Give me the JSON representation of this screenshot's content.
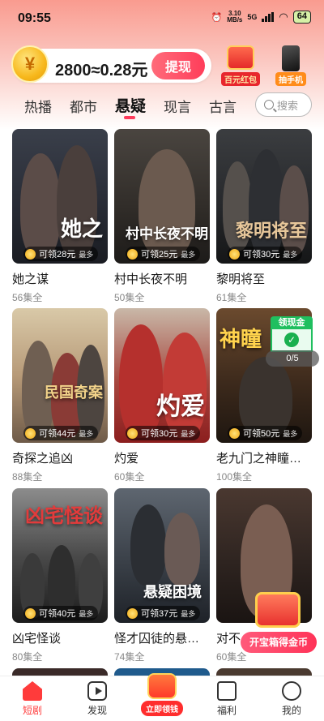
{
  "status_bar": {
    "time": "09:55",
    "net_speed": "3.10",
    "net_unit": "MB/s",
    "network": "5G",
    "battery": "64"
  },
  "reward": {
    "coin_symbol": "¥",
    "amount": "2800≈0.28元",
    "withdraw_label": "提现"
  },
  "promos": [
    {
      "label": "百元红包",
      "icon": "red-envelope-icon"
    },
    {
      "label": "抽手机",
      "icon": "phone-icon"
    }
  ],
  "tabs": [
    {
      "label": "热播",
      "active": false
    },
    {
      "label": "都市",
      "active": false
    },
    {
      "label": "悬疑",
      "active": true
    },
    {
      "label": "现言",
      "active": false
    },
    {
      "label": "古言",
      "active": false
    }
  ],
  "search": {
    "placeholder": "搜索"
  },
  "dramas": [
    {
      "title": "她之谋",
      "episodes": "56集全",
      "reward": "可领28元",
      "tag": "最多",
      "art_title": "她之"
    },
    {
      "title": "村中长夜不明",
      "episodes": "50集全",
      "reward": "可领25元",
      "tag": "最多",
      "art_title": "村中长夜不明"
    },
    {
      "title": "黎明将至",
      "episodes": "61集全",
      "reward": "可领30元",
      "tag": "最多",
      "art_title": "黎明将至"
    },
    {
      "title": "奇探之追凶",
      "episodes": "88集全",
      "reward": "可领44元",
      "tag": "最多",
      "art_title": "民国奇案"
    },
    {
      "title": "灼爱",
      "episodes": "60集全",
      "reward": "可领30元",
      "tag": "最多",
      "art_title": "灼爱"
    },
    {
      "title": "老九门之神瞳…",
      "episodes": "100集全",
      "reward": "可领50元",
      "tag": "最多",
      "art_title": "神瞳"
    },
    {
      "title": "凶宅怪谈",
      "episodes": "80集全",
      "reward": "可领40元",
      "tag": "最多",
      "art_title": "凶宅怪谈"
    },
    {
      "title": "怪才囚徒的悬…",
      "episodes": "74集全",
      "reward": "可领37元",
      "tag": "最多",
      "art_title": "悬疑困境"
    },
    {
      "title": "对不…",
      "episodes": "60集全",
      "reward": "",
      "tag": "",
      "art_title": ""
    }
  ],
  "cash_widget": {
    "title": "领现金",
    "progress": "0/5"
  },
  "chest": {
    "label": "开宝箱得金币"
  },
  "bottom_nav": {
    "home": "短剧",
    "discover": "发现",
    "center": "立即领钱",
    "welfare": "福利",
    "me": "我的"
  }
}
